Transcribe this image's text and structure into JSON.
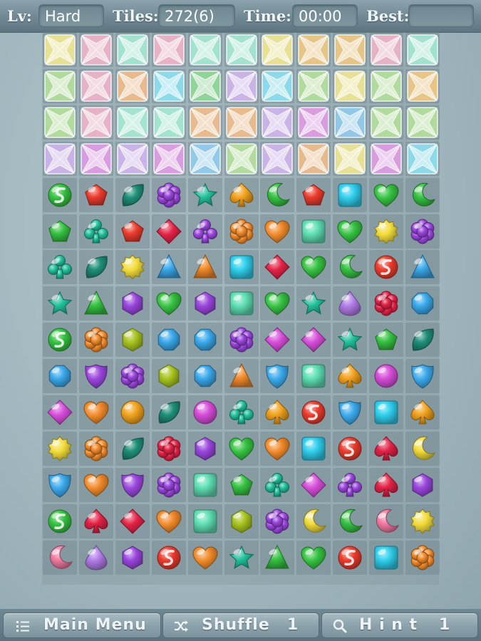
{
  "header": {
    "level_label": "Lv:",
    "level_value": "Hard",
    "tiles_label": "Tiles:",
    "tiles_value": "272(6)",
    "time_label": "Time:",
    "time_value": "00:00",
    "best_label": "Best:",
    "best_value": ""
  },
  "footer": {
    "main_menu_label": "Main Menu",
    "shuffle_label": "Shuffle",
    "shuffle_count": "1",
    "hint_label": "H i n t",
    "hint_count": "1"
  },
  "board": {
    "columns": 11,
    "rows": 15,
    "colors": {
      "yellow": "#f2dc3a",
      "pink": "#f27aa0",
      "mint": "#5fe0b4",
      "teal": "#1fbf9a",
      "green": "#35c241",
      "red": "#ec3b2c",
      "orange": "#f28a2a",
      "amber": "#f2a21c",
      "purple": "#9a45dd",
      "violet": "#b27ce8",
      "blue": "#3aa9ec",
      "cyan": "#2fd0ee",
      "magenta": "#d64bd9",
      "darkteal": "#1e8f78",
      "olive": "#a7c41e",
      "lime": "#7fd24a",
      "crimson": "#e32246",
      "lilac": "#c99be8"
    },
    "frozen_rows": [
      [
        "yellow",
        "pink",
        "mint",
        "pink",
        "mint",
        "mint",
        "yellow",
        "amber",
        "amber",
        "pink",
        "mint"
      ],
      [
        "lime",
        "pink",
        "orange",
        "cyan",
        "green",
        "violet",
        "cyan",
        "lime",
        "yellow",
        "lime",
        "amber"
      ],
      [
        "lime",
        "pink",
        "mint",
        "mint",
        "orange",
        "orange",
        "violet",
        "magenta",
        "blue",
        "lime",
        "lime"
      ],
      [
        "violet",
        "magenta",
        "violet",
        "magenta",
        "blue",
        "lime",
        "violet",
        "orange",
        "yellow",
        "magenta",
        "cyan"
      ]
    ],
    "gem_rows": [
      [
        [
          "s-ball",
          "green"
        ],
        [
          "pentagon",
          "red"
        ],
        [
          "leaf",
          "darkteal"
        ],
        [
          "flower",
          "purple"
        ],
        [
          "star",
          "teal"
        ],
        [
          "spade",
          "amber"
        ],
        [
          "moon",
          "green"
        ],
        [
          "pentagon",
          "red"
        ],
        [
          "square",
          "cyan"
        ],
        [
          "heart",
          "green"
        ],
        [
          "moon",
          "green"
        ]
      ],
      [
        [
          "pentagon",
          "green"
        ],
        [
          "club",
          "teal"
        ],
        [
          "pentagon",
          "red"
        ],
        [
          "diamond",
          "crimson"
        ],
        [
          "club",
          "purple"
        ],
        [
          "flower",
          "orange"
        ],
        [
          "heart",
          "orange"
        ],
        [
          "square",
          "mint"
        ],
        [
          "heart",
          "green"
        ],
        [
          "sun",
          "yellow"
        ],
        [
          "flower",
          "purple"
        ]
      ],
      [
        [
          "club",
          "teal"
        ],
        [
          "leaf",
          "darkteal"
        ],
        [
          "sun",
          "yellow"
        ],
        [
          "triangle",
          "blue"
        ],
        [
          "triangle",
          "orange"
        ],
        [
          "square",
          "cyan"
        ],
        [
          "diamond",
          "crimson"
        ],
        [
          "heart",
          "green"
        ],
        [
          "moon",
          "green"
        ],
        [
          "s-ball",
          "red"
        ],
        [
          "triangle",
          "blue"
        ]
      ],
      [
        [
          "star",
          "teal"
        ],
        [
          "triangle",
          "green"
        ],
        [
          "hexagon",
          "purple"
        ],
        [
          "heart",
          "green"
        ],
        [
          "hexagon",
          "purple"
        ],
        [
          "square",
          "mint"
        ],
        [
          "heart",
          "green"
        ],
        [
          "star",
          "teal"
        ],
        [
          "drop",
          "violet"
        ],
        [
          "flower",
          "crimson"
        ],
        [
          "octagon",
          "blue"
        ]
      ],
      [
        [
          "s-ball",
          "green"
        ],
        [
          "flower",
          "orange"
        ],
        [
          "hexagon",
          "olive"
        ],
        [
          "octagon",
          "blue"
        ],
        [
          "octagon",
          "blue"
        ],
        [
          "flower",
          "purple"
        ],
        [
          "diamond",
          "magenta"
        ],
        [
          "diamond",
          "magenta"
        ],
        [
          "star",
          "teal"
        ],
        [
          "pentagon",
          "green"
        ],
        [
          "leaf",
          "darkteal"
        ]
      ],
      [
        [
          "octagon",
          "blue"
        ],
        [
          "shield",
          "purple"
        ],
        [
          "flower",
          "purple"
        ],
        [
          "hexagon",
          "olive"
        ],
        [
          "octagon",
          "blue"
        ],
        [
          "triangle",
          "orange"
        ],
        [
          "shield",
          "blue"
        ],
        [
          "square",
          "mint"
        ],
        [
          "spade",
          "amber"
        ],
        [
          "ball",
          "magenta"
        ],
        [
          "shield",
          "blue"
        ]
      ],
      [
        [
          "diamond",
          "magenta"
        ],
        [
          "heart",
          "orange"
        ],
        [
          "ball",
          "amber"
        ],
        [
          "leaf",
          "darkteal"
        ],
        [
          "ball",
          "magenta"
        ],
        [
          "club",
          "teal"
        ],
        [
          "spade",
          "amber"
        ],
        [
          "s-ball",
          "red"
        ],
        [
          "shield",
          "blue"
        ],
        [
          "square",
          "cyan"
        ],
        [
          "spade",
          "amber"
        ]
      ],
      [
        [
          "sun",
          "yellow"
        ],
        [
          "flower",
          "orange"
        ],
        [
          "leaf",
          "darkteal"
        ],
        [
          "flower",
          "crimson"
        ],
        [
          "hexagon",
          "purple"
        ],
        [
          "heart",
          "green"
        ],
        [
          "heart",
          "orange"
        ],
        [
          "square",
          "cyan"
        ],
        [
          "s-ball",
          "red"
        ],
        [
          "spade",
          "crimson"
        ],
        [
          "moon",
          "yellow"
        ]
      ],
      [
        [
          "shield",
          "blue"
        ],
        [
          "heart",
          "orange"
        ],
        [
          "shield",
          "purple"
        ],
        [
          "flower",
          "purple"
        ],
        [
          "square",
          "mint"
        ],
        [
          "pentagon",
          "green"
        ],
        [
          "club",
          "teal"
        ],
        [
          "diamond",
          "magenta"
        ],
        [
          "club",
          "purple"
        ],
        [
          "spade",
          "crimson"
        ],
        [
          "hexagon",
          "purple"
        ]
      ],
      [
        [
          "s-ball",
          "green"
        ],
        [
          "spade",
          "crimson"
        ],
        [
          "diamond",
          "crimson"
        ],
        [
          "heart",
          "orange"
        ],
        [
          "square",
          "mint"
        ],
        [
          "hexagon",
          "olive"
        ],
        [
          "flower",
          "purple"
        ],
        [
          "moon",
          "yellow"
        ],
        [
          "moon",
          "green"
        ],
        [
          "moon",
          "pink"
        ],
        [
          "sun",
          "yellow"
        ]
      ],
      [
        [
          "moon",
          "pink"
        ],
        [
          "drop",
          "violet"
        ],
        [
          "hexagon",
          "purple"
        ],
        [
          "s-ball",
          "red"
        ],
        [
          "heart",
          "orange"
        ],
        [
          "star",
          "teal"
        ],
        [
          "triangle",
          "green"
        ],
        [
          "heart",
          "green"
        ],
        [
          "s-ball",
          "red"
        ],
        [
          "square",
          "cyan"
        ],
        [
          "flower",
          "orange"
        ]
      ]
    ]
  }
}
